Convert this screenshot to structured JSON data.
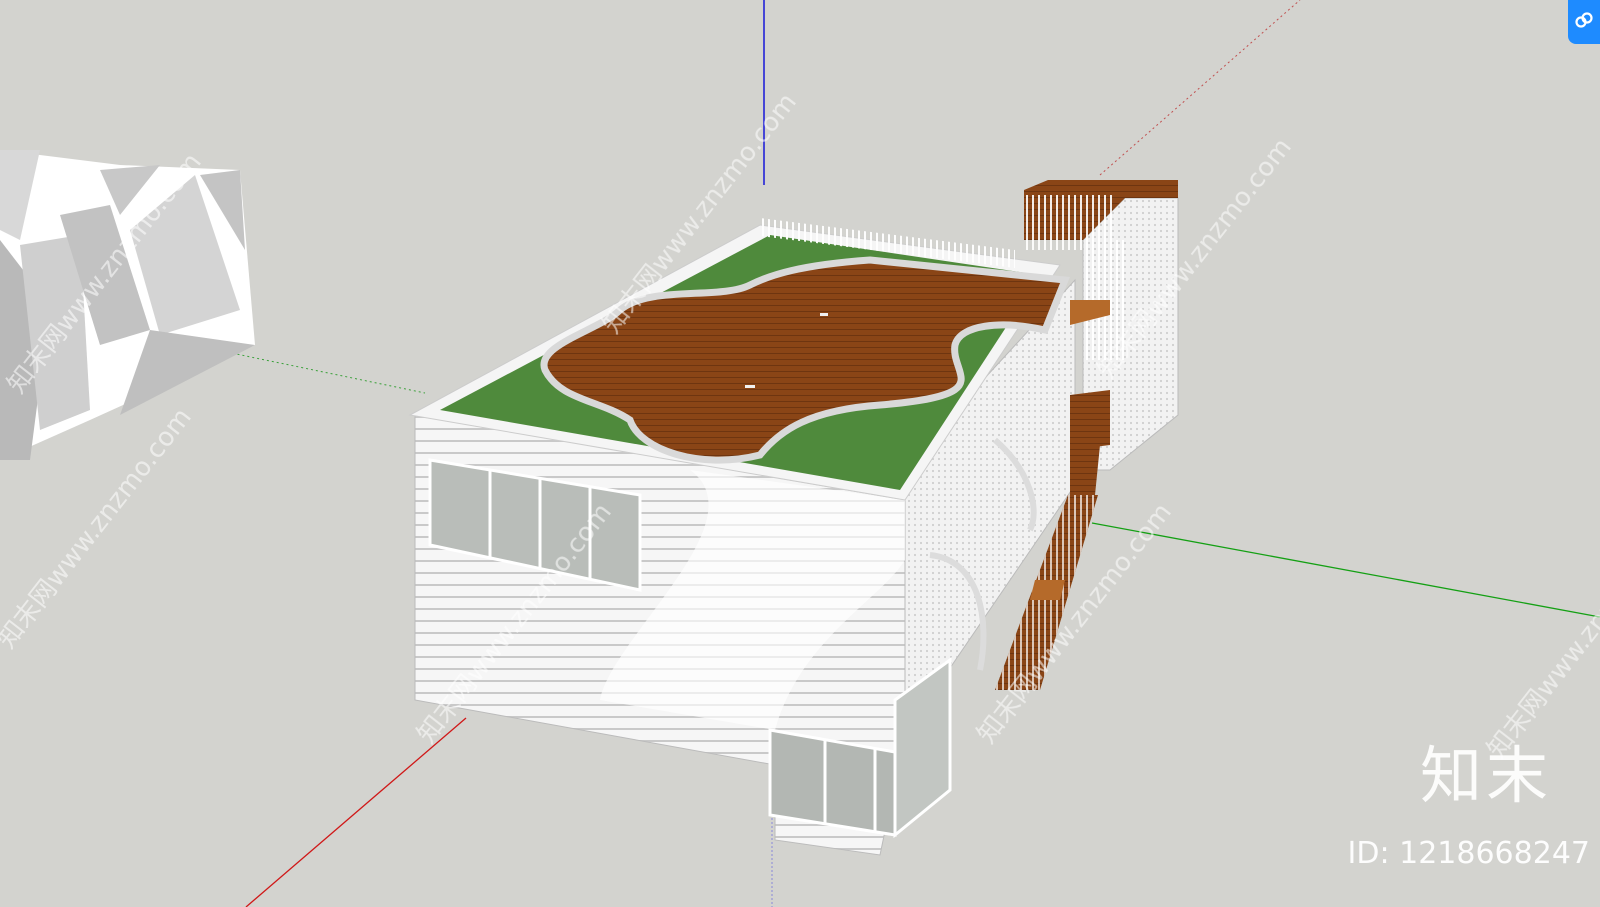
{
  "watermark": {
    "logo_text": "知末",
    "id_text": "ID: 1218668247",
    "diagonal_text": "知末网www.znzmo.com"
  },
  "colors": {
    "background": "#d3d3cf",
    "grass": "#4f8a3c",
    "wood": "#8a4516",
    "wall": "#f4f4f4",
    "glass": "#b9bdb9",
    "axis_red": "#d01818",
    "axis_green": "#14a014",
    "axis_blue": "#1818d8",
    "link_button": "#1e8bff"
  },
  "icons": {
    "link": "link-icon"
  }
}
